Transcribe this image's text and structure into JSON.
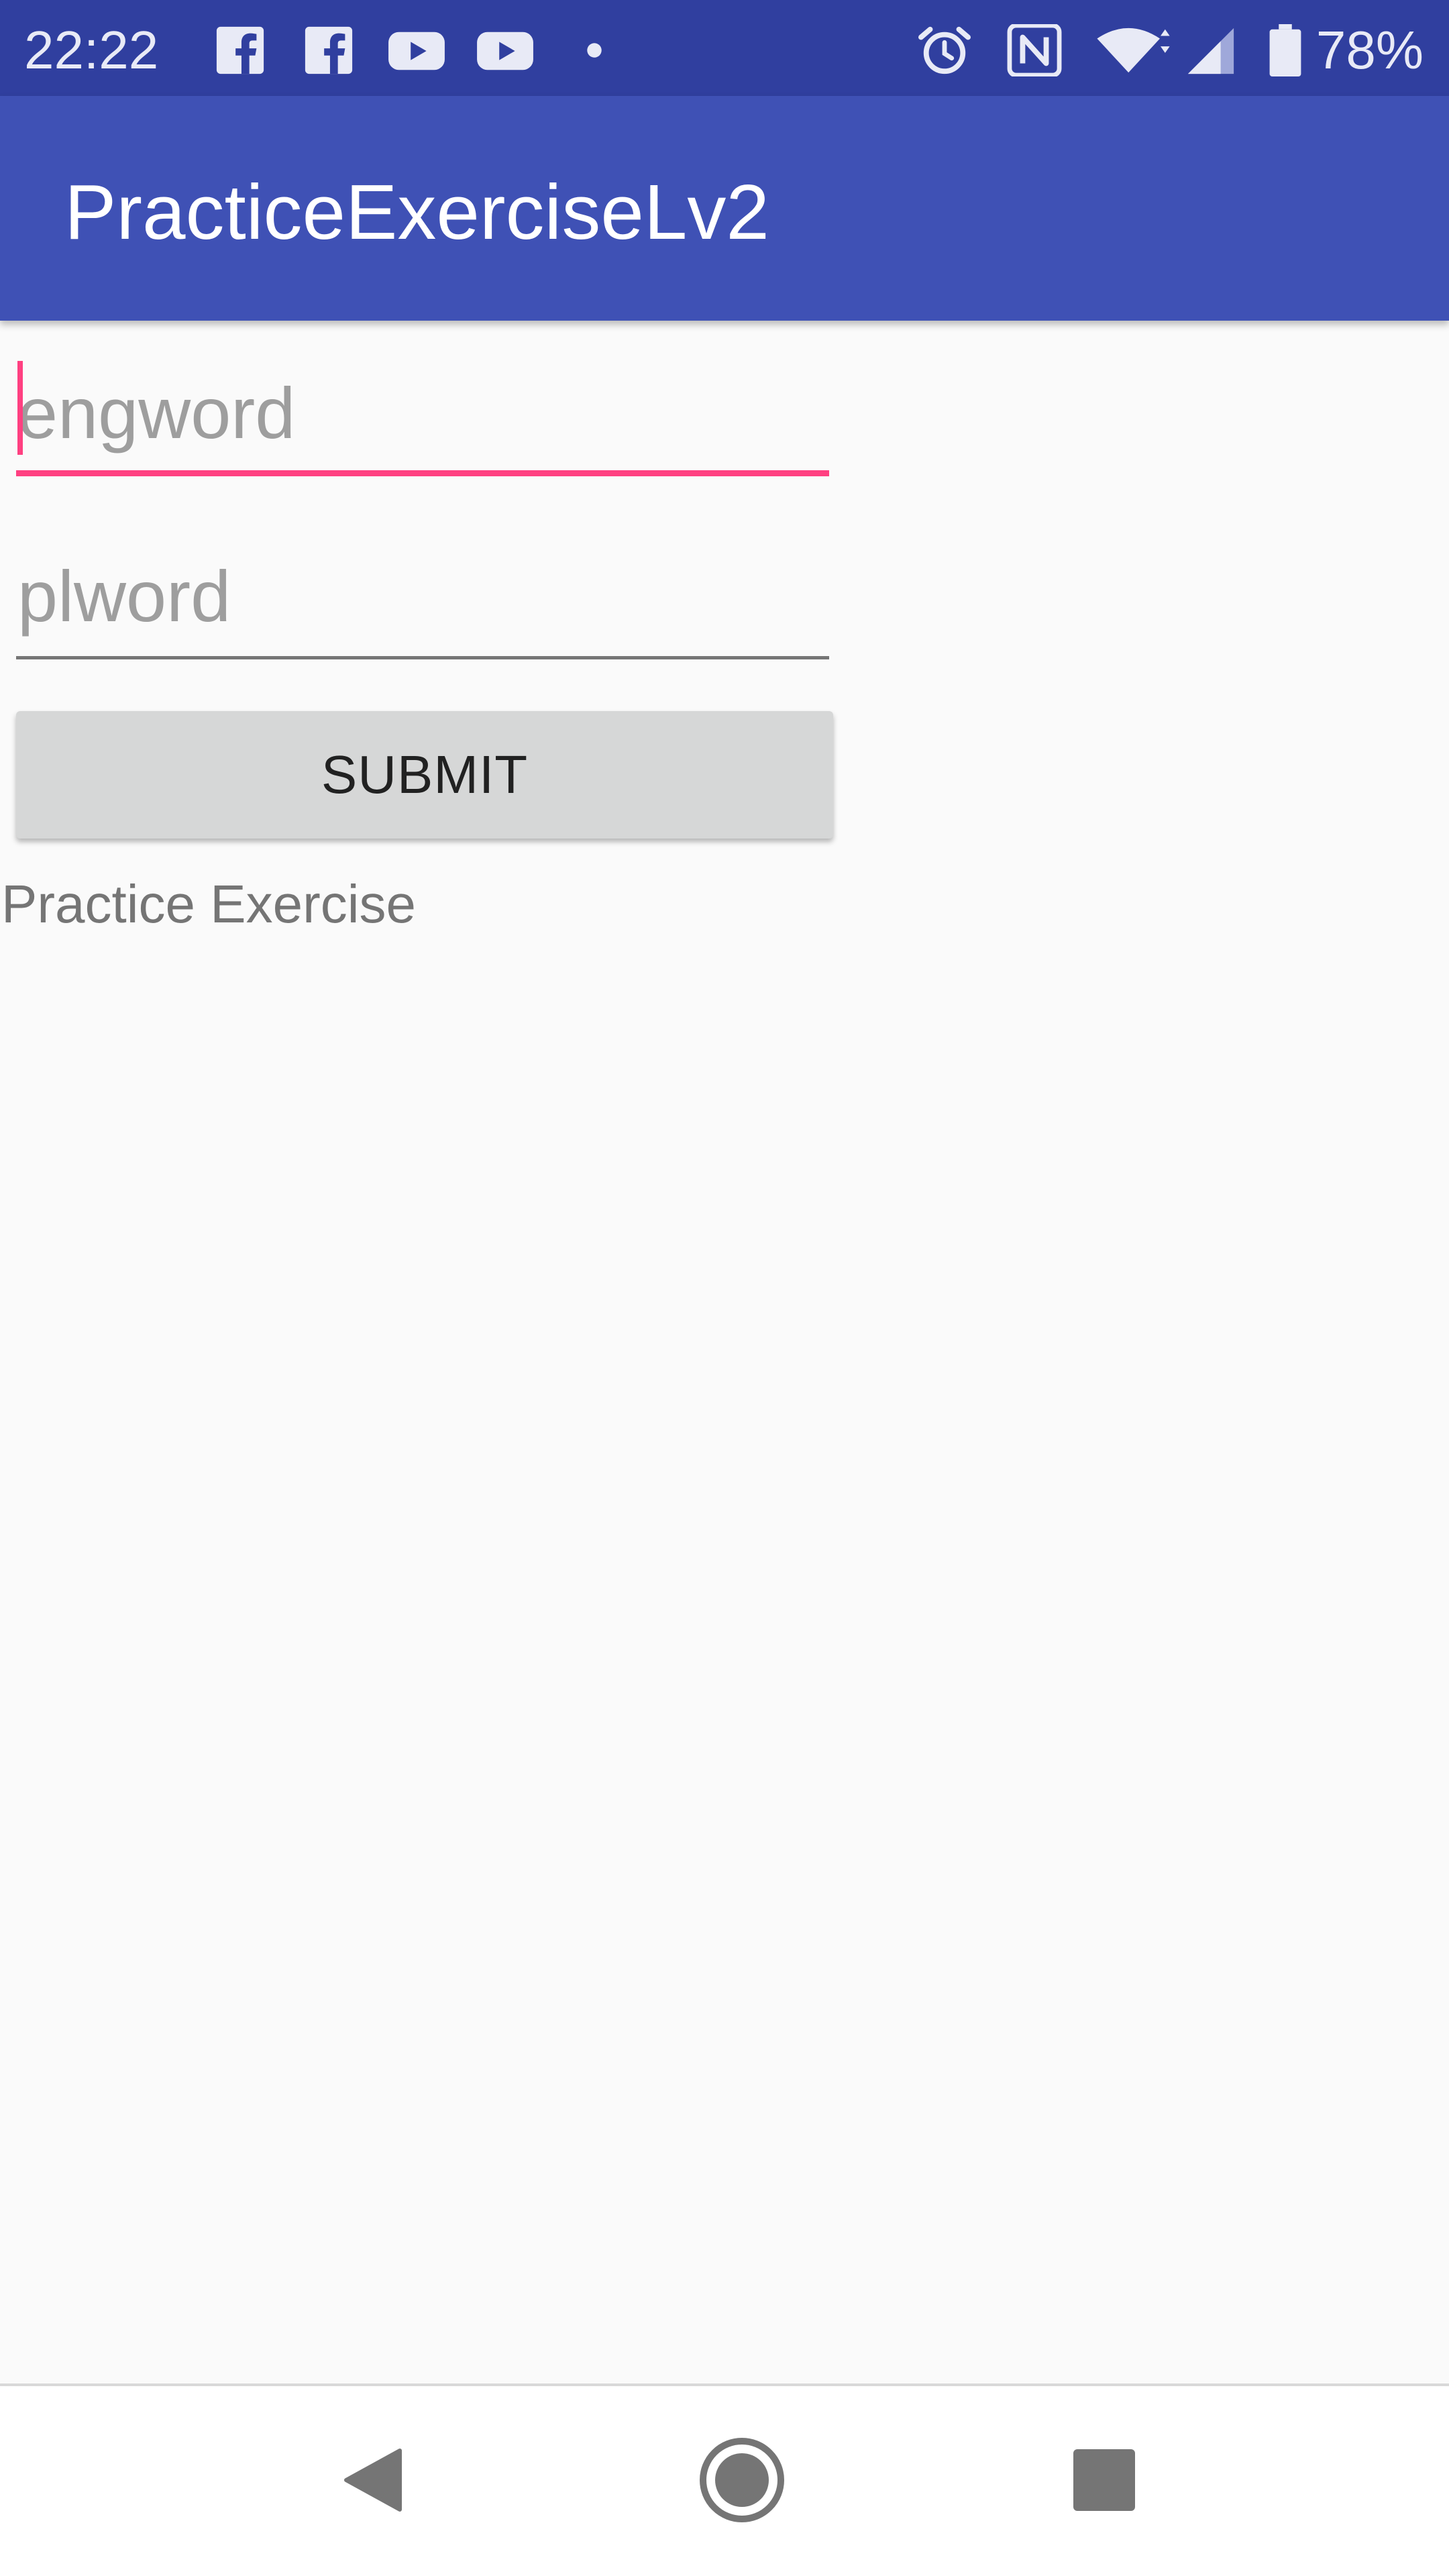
{
  "status_bar": {
    "time": "22:22",
    "battery_percent": "78%",
    "left_icons": [
      "facebook-icon",
      "facebook-icon",
      "youtube-icon",
      "youtube-icon",
      "notification-dot-icon"
    ],
    "right_icons": [
      "alarm-icon",
      "nfc-icon",
      "wifi-icon",
      "signal-icon",
      "battery-icon"
    ],
    "battery_level": 0.78,
    "background_color": "#303f9f"
  },
  "app_bar": {
    "title": "PracticeExerciseLv2",
    "background_color": "#3f51b5"
  },
  "form": {
    "eng_field": {
      "placeholder": "engword",
      "value": "",
      "focused": true,
      "accent_color": "#ff4081"
    },
    "pl_field": {
      "placeholder": "plword",
      "value": ""
    },
    "submit_label": "SUBMIT"
  },
  "info_text": "Practice Exercise",
  "nav_bar": {
    "icons": [
      "back-icon",
      "home-icon",
      "recents-icon"
    ]
  }
}
